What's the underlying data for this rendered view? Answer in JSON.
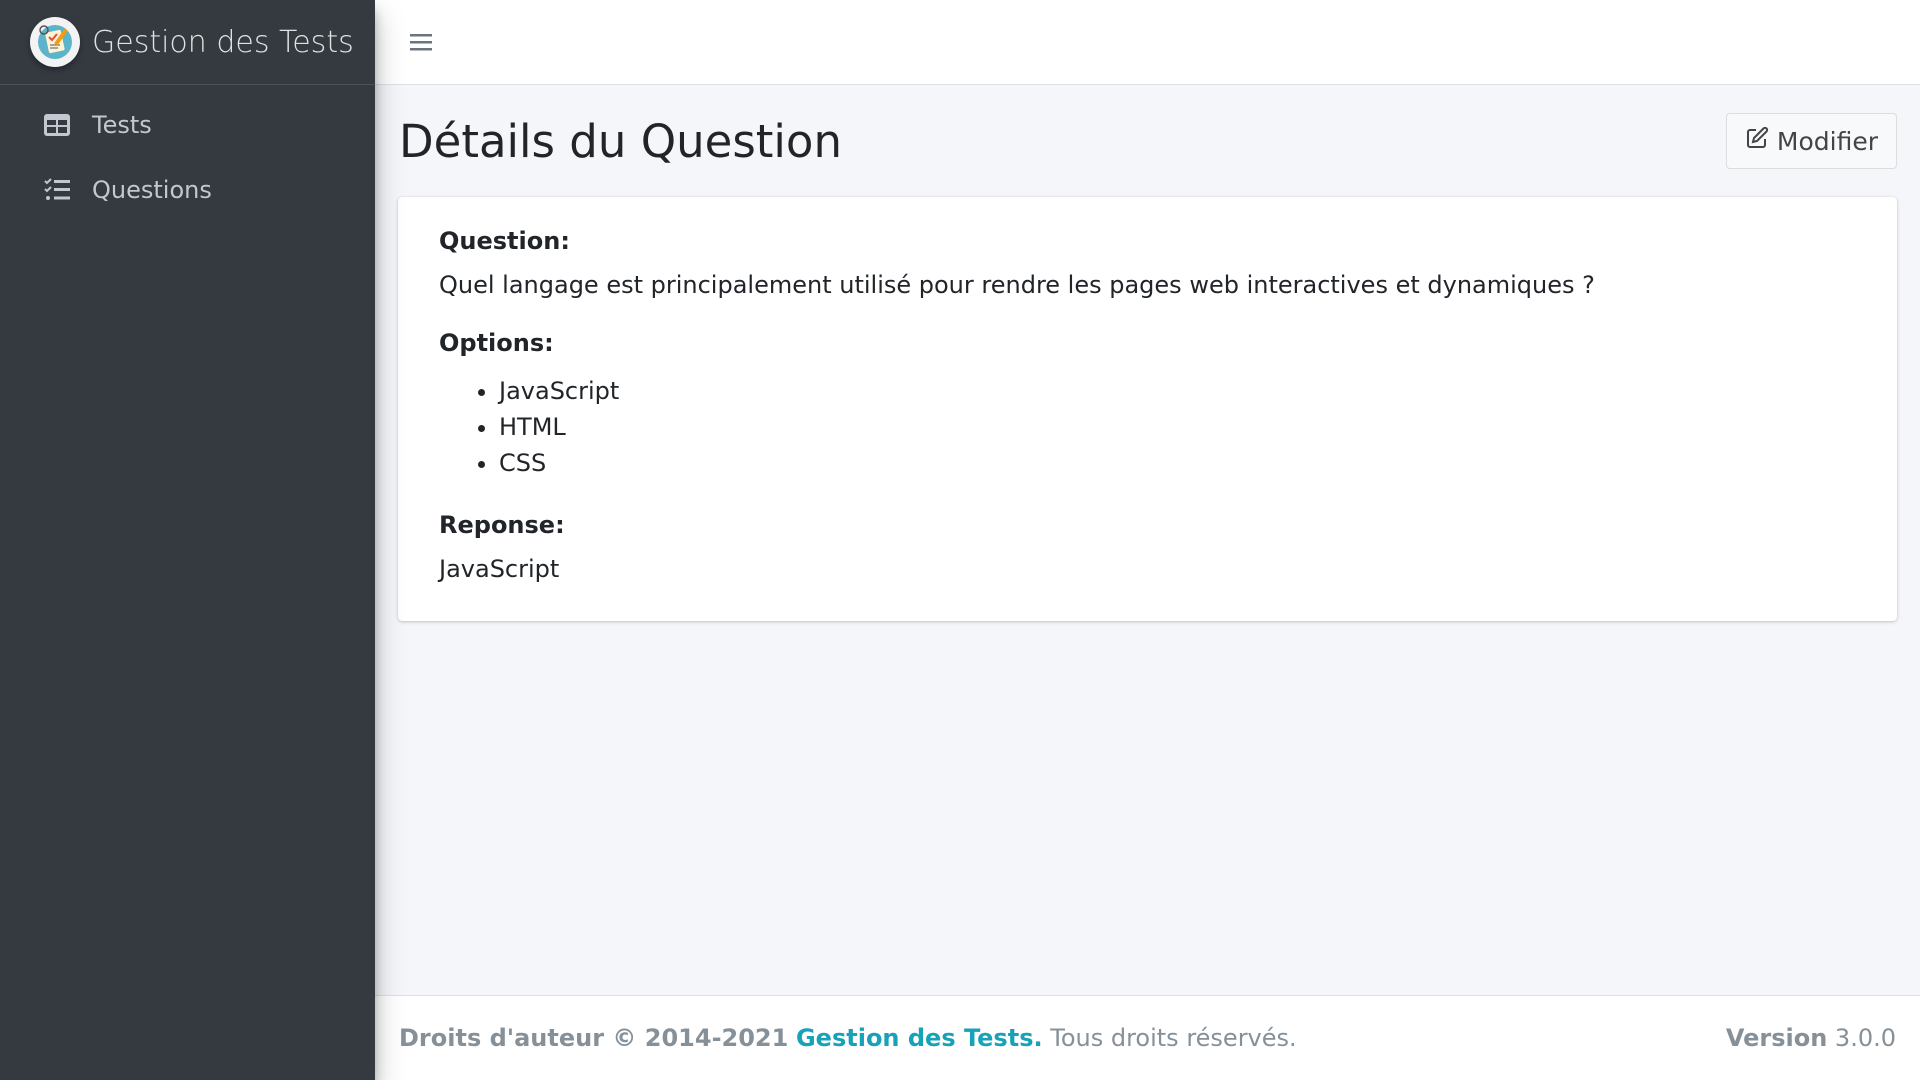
{
  "app": {
    "brand_name": "Gestion des Tests",
    "brand_logo_icon": "test-app-logo",
    "accent_color": "#17a2b8"
  },
  "sidebar": {
    "items": [
      {
        "label": "Tests",
        "icon": "table-icon"
      },
      {
        "label": "Questions",
        "icon": "list-check-icon"
      }
    ]
  },
  "navbar": {
    "menu_icon": "hamburger-icon"
  },
  "page": {
    "title": "Détails du Question",
    "edit_label": "Modifier",
    "edit_icon": "edit-icon"
  },
  "question": {
    "question_label": "Question:",
    "question_text": "Quel langage est principalement utilisé pour rendre les pages web interactives et dynamiques ?",
    "options_label": "Options:",
    "options": [
      "JavaScript",
      "HTML",
      "CSS"
    ],
    "answer_label": "Reponse:",
    "answer_text": "JavaScript"
  },
  "footer": {
    "copyright_prefix": "Droits d'auteur © 2014-2021",
    "copyright_link": "Gestion des Tests.",
    "rights_text": "Tous droits réservés.",
    "version_label": "Version",
    "version_number": "3.0.0"
  }
}
